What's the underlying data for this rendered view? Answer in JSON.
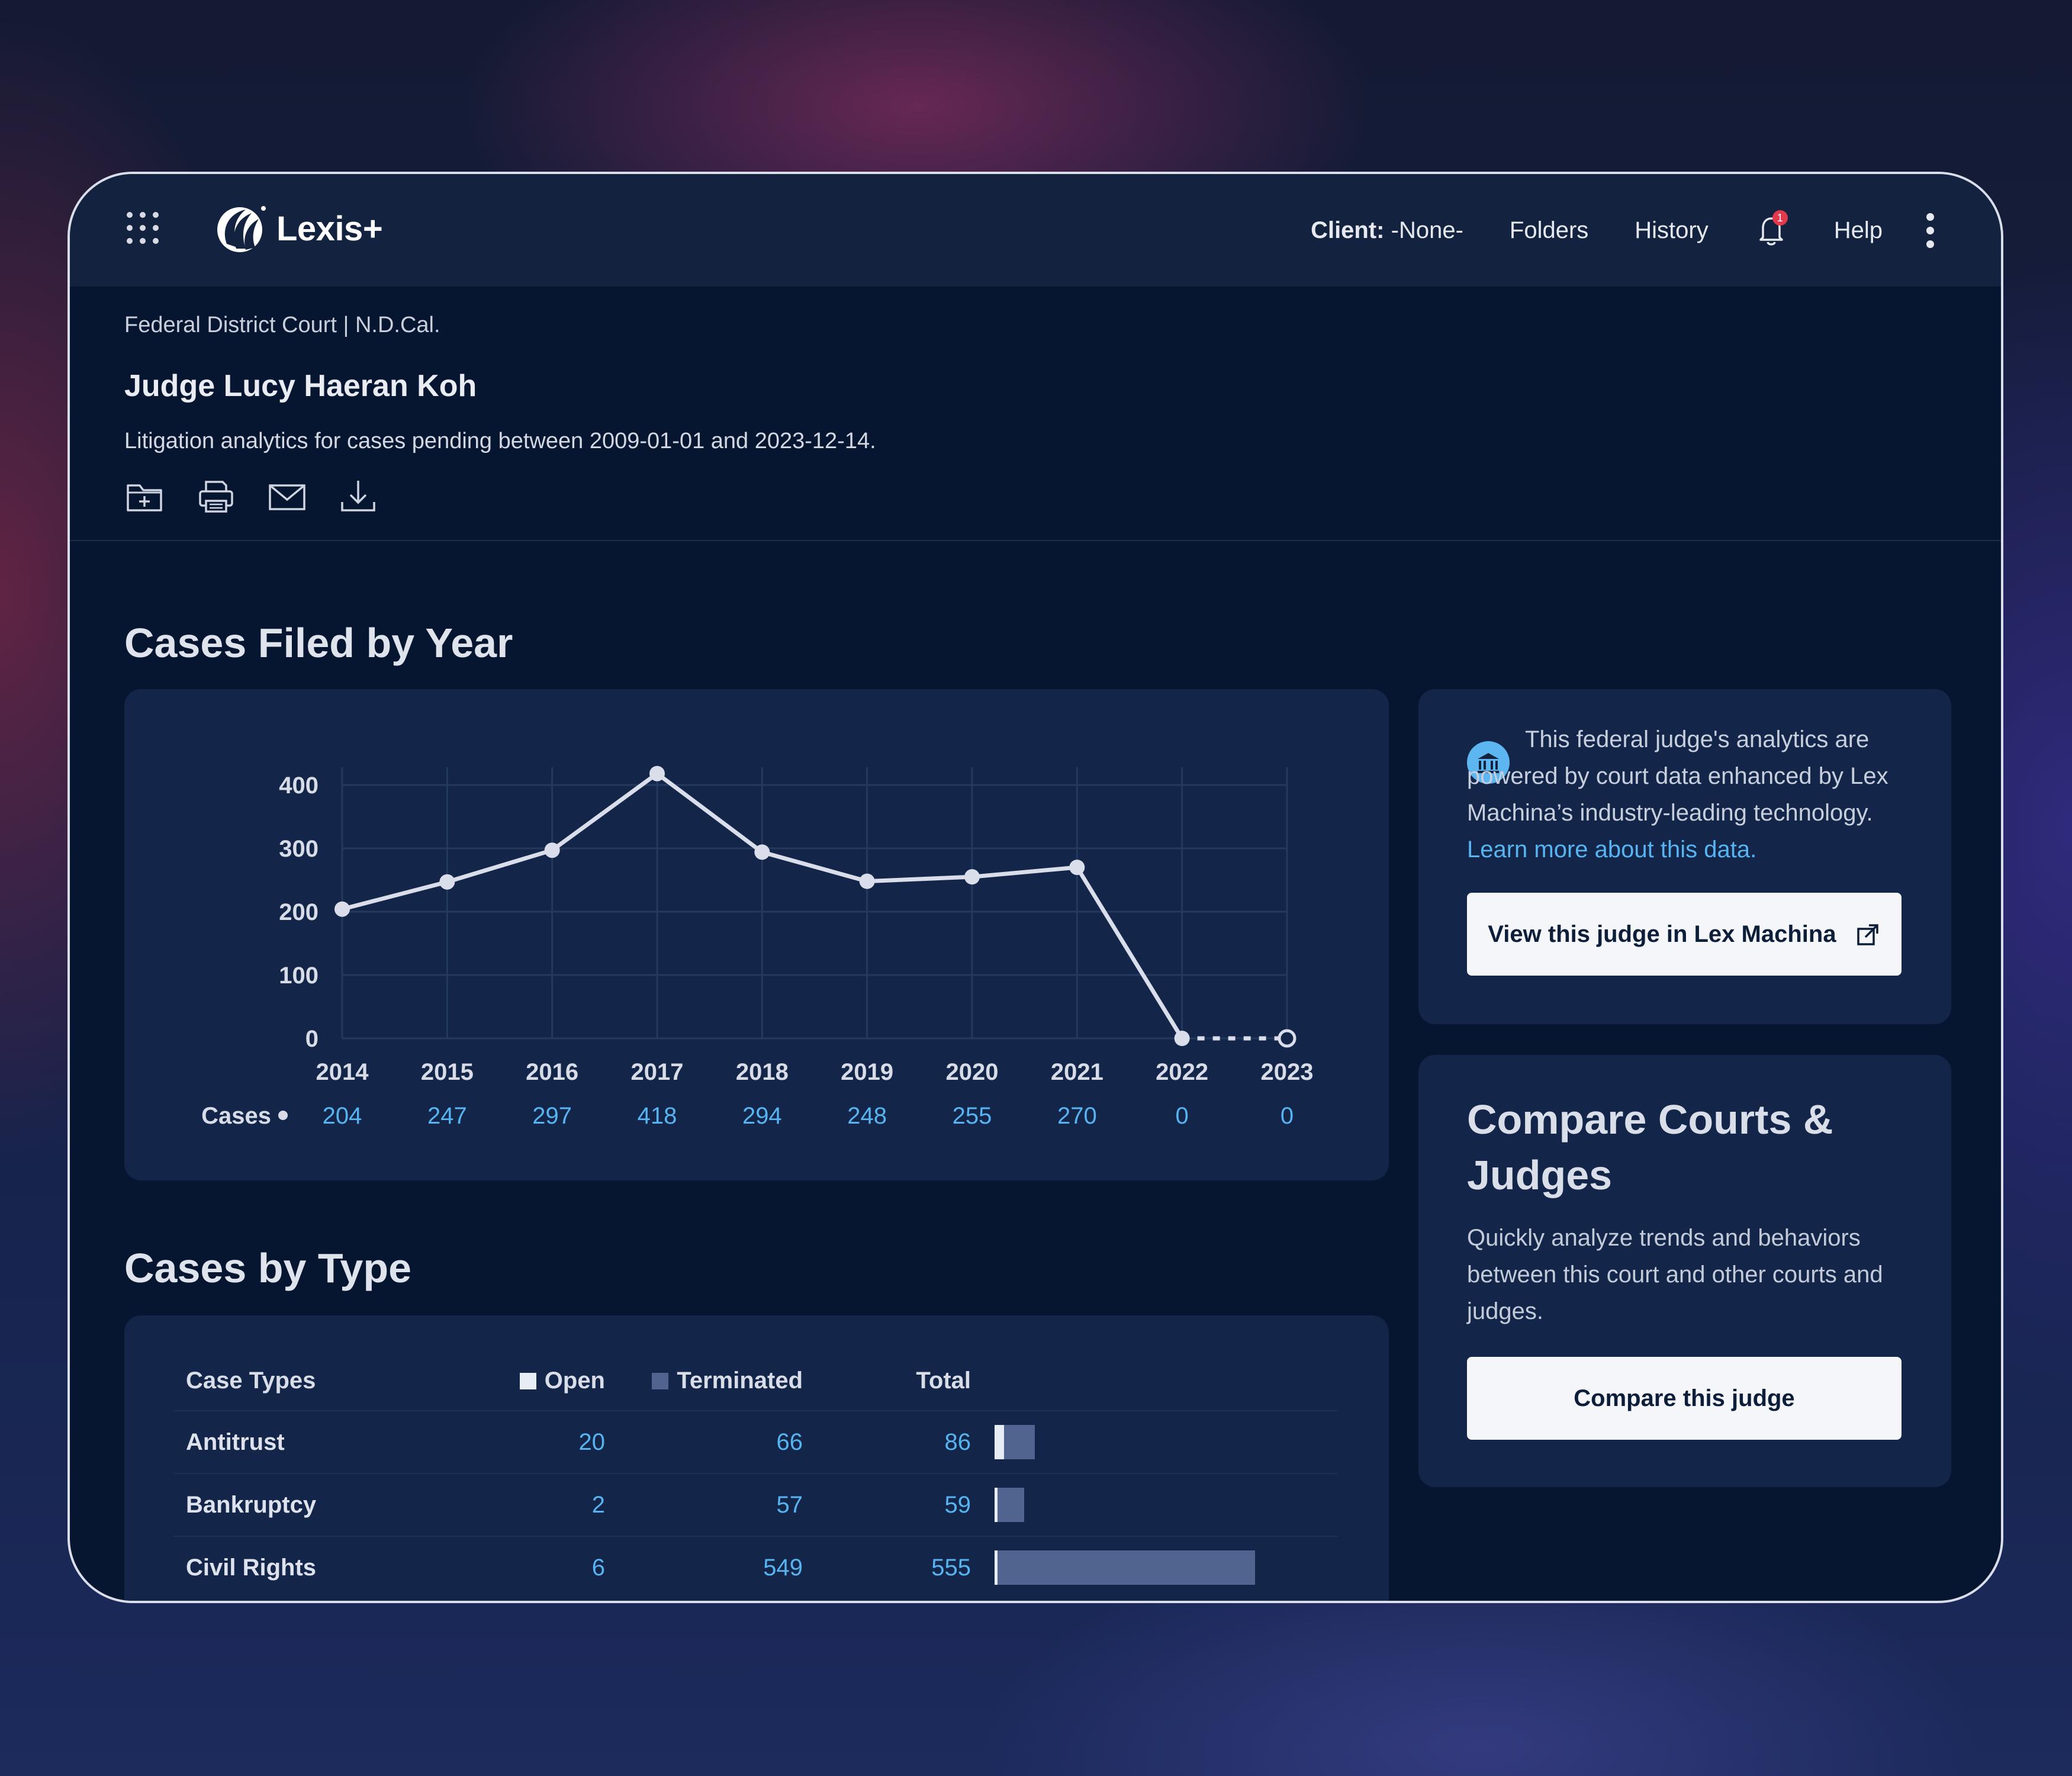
{
  "topbar": {
    "app_name": "Lexis+",
    "client_label": "Client:",
    "client_value": "-None-",
    "nav": {
      "folders": "Folders",
      "history": "History",
      "help": "Help"
    },
    "notification_count": "1"
  },
  "header": {
    "breadcrumb": "Federal District Court  | N.D.Cal.",
    "judge_name": "Judge Lucy Haeran Koh",
    "subtitle": "Litigation analytics for cases pending between 2009-01-01 and 2023-12-14.",
    "actions": [
      "add-to-folder-icon",
      "print-icon",
      "email-icon",
      "download-icon"
    ]
  },
  "sections": {
    "cases_filed_title": "Cases Filed by Year",
    "cases_type_title": "Cases by Type"
  },
  "chart_data": {
    "type": "line",
    "categories": [
      "2014",
      "2015",
      "2016",
      "2017",
      "2018",
      "2019",
      "2020",
      "2021",
      "2022",
      "2023"
    ],
    "series": [
      {
        "name": "Cases",
        "values": [
          204,
          247,
          297,
          418,
          294,
          248,
          255,
          270,
          0,
          0
        ]
      }
    ],
    "value_labels": [
      "204",
      "247",
      "297",
      "418",
      "294",
      "248",
      "255",
      "270",
      "0",
      "0"
    ],
    "yticks": [
      "400",
      "300",
      "200",
      "100",
      "0"
    ],
    "ylim": [
      0,
      400
    ],
    "grid": true,
    "row_label": "Cases",
    "colors": {
      "line": "#d9deea",
      "values": "#58b4f0",
      "grid": "#233a5e"
    }
  },
  "case_types": {
    "headers": {
      "type": "Case Types",
      "open": "Open",
      "terminated": "Terminated",
      "total": "Total"
    },
    "rows": [
      {
        "name": "Antitrust",
        "open": "20",
        "terminated": "66",
        "total": "86"
      },
      {
        "name": "Bankruptcy",
        "open": "2",
        "terminated": "57",
        "total": "59"
      },
      {
        "name": "Civil Rights",
        "open": "6",
        "terminated": "549",
        "total": "555"
      }
    ],
    "colors": {
      "open": "#e8ecf4",
      "terminated": "#51648f"
    }
  },
  "info": {
    "text": "This federal judge's analytics are powered by court data enhanced by Lex Machina’s industry-leading technology.",
    "link": "Learn more about this data.",
    "button": "View this judge in Lex Machina"
  },
  "compare": {
    "title": "Compare Courts & Judges",
    "text": "Quickly analyze trends and behaviors between this court and other courts and judges.",
    "button": "Compare this judge"
  }
}
